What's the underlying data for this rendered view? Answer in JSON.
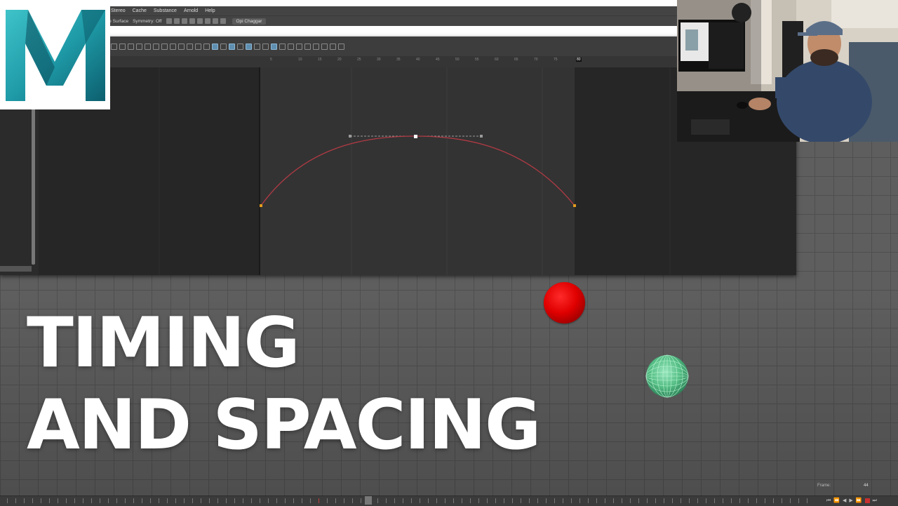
{
  "menubar": {
    "items": [
      "Stereo",
      "Cache",
      "Substance",
      "Arnold",
      "Help"
    ]
  },
  "statusline": {
    "surface_label": "ve Surface",
    "symmetry_label": "Symmetry: Off",
    "user_name": "Opi Chaggar"
  },
  "graph_editor": {
    "ruler_ticks": [
      "5",
      "10",
      "15",
      "20",
      "25",
      "30",
      "35",
      "40",
      "45",
      "50",
      "55",
      "60",
      "65",
      "70",
      "75",
      "80"
    ],
    "end_frame_label": "80"
  },
  "thumbnail": {
    "title_line_1": "TIMING",
    "title_line_2": "AND SPACING"
  },
  "timeline": {
    "frame_label": "Frame:",
    "frame_value": "44"
  },
  "colors": {
    "ball_red": "#e00000",
    "ball_green": "#6fe0a8",
    "curve": "#b03a44",
    "logo_teal": "#1f9ba8"
  }
}
